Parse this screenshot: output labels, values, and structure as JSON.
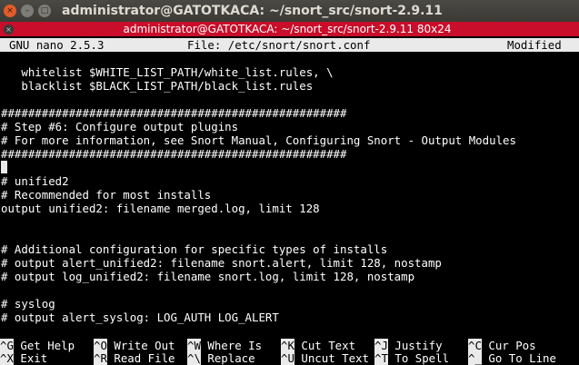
{
  "window": {
    "title": "administrator@GATOTKACA: ~/snort_src/snort-2.9.11",
    "close_glyph": "×",
    "minimize_glyph": "–",
    "maximize_glyph": "□"
  },
  "terminal_tab": {
    "title": "administrator@GATOTKACA: ~/snort_src/snort-2.9.11 80x24",
    "close_glyph": "×",
    "accent": "#c80e2a"
  },
  "nano": {
    "version": "GNU nano 2.5.3",
    "file": "File: /etc/snort/snort.conf",
    "status": "Modified"
  },
  "lines": [
    "",
    "   whitelist $WHITE_LIST_PATH/white_list.rules, \\",
    "   blacklist $BLACK_LIST_PATH/black_list.rules",
    "",
    "###################################################",
    "# Step #6: Configure output plugins",
    "# For more information, see Snort Manual, Configuring Snort - Output Modules",
    "###################################################",
    "",
    "# unified2",
    "# Recommended for most installs",
    "output unified2: filename merged.log, limit 128",
    "",
    "",
    "# Additional configuration for specific types of installs",
    "# output alert_unified2: filename snort.alert, limit 128, nostamp",
    "# output log_unified2: filename snort.log, limit 128, nostamp",
    "",
    "# syslog",
    "# output alert_syslog: LOG_AUTH LOG_ALERT"
  ],
  "shortcuts_row1": [
    {
      "key": "^G",
      "label": "Get Help"
    },
    {
      "key": "^O",
      "label": "Write Out"
    },
    {
      "key": "^W",
      "label": "Where Is"
    },
    {
      "key": "^K",
      "label": "Cut Text"
    },
    {
      "key": "^J",
      "label": "Justify"
    },
    {
      "key": "^C",
      "label": "Cur Pos"
    }
  ],
  "shortcuts_row2": [
    {
      "key": "^X",
      "label": "Exit"
    },
    {
      "key": "^R",
      "label": "Read File"
    },
    {
      "key": "^\\",
      "label": "Replace"
    },
    {
      "key": "^U",
      "label": "Uncut Text"
    },
    {
      "key": "^T",
      "label": "To Spell"
    },
    {
      "key": "^_",
      "label": "Go To Line"
    }
  ]
}
